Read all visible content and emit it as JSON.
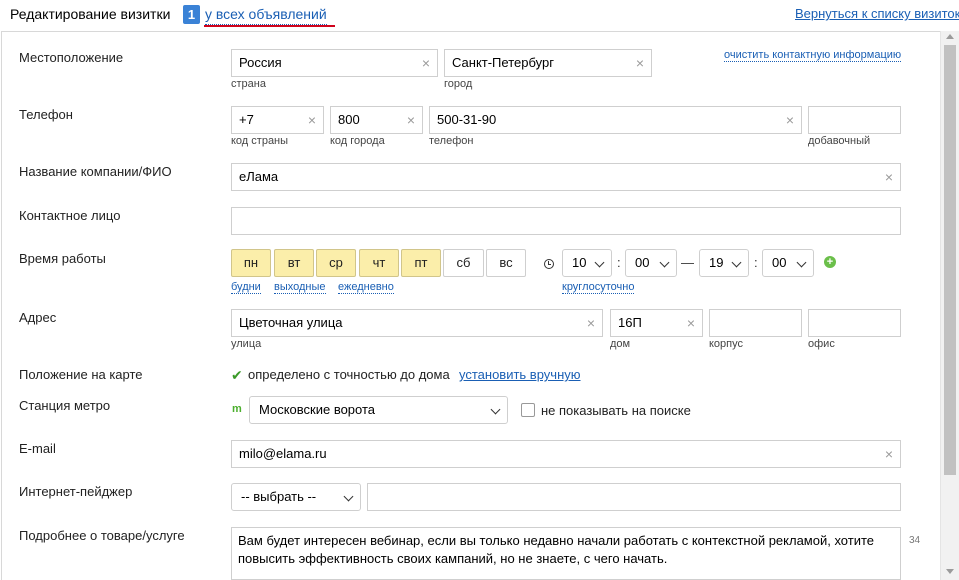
{
  "header": {
    "title": "Редактирование визитки",
    "badge": "1",
    "scope_link": "у всех объявлений",
    "back_link": "Вернуться к списку визиток"
  },
  "location": {
    "label": "Местоположение",
    "country_value": "Россия",
    "country_sub": "страна",
    "city_value": "Санкт-Петербург",
    "city_sub": "город",
    "clear_link": "очистить контактную информацию"
  },
  "phone": {
    "label": "Телефон",
    "country_code": "+7",
    "country_code_sub": "код страны",
    "city_code": "800",
    "city_code_sub": "код города",
    "number": "500-31-90",
    "number_sub": "телефон",
    "extension": "",
    "extension_sub": "добавочный"
  },
  "company": {
    "label": "Название компании/ФИО",
    "value": "еЛама"
  },
  "contact": {
    "label": "Контактное лицо",
    "value": ""
  },
  "hours": {
    "label": "Время работы",
    "days": [
      {
        "label": "пн",
        "active": true
      },
      {
        "label": "вт",
        "active": true
      },
      {
        "label": "ср",
        "active": true
      },
      {
        "label": "чт",
        "active": true
      },
      {
        "label": "пт",
        "active": true
      },
      {
        "label": "сб",
        "active": false
      },
      {
        "label": "вс",
        "active": false
      }
    ],
    "preset_weekdays": "будни",
    "preset_weekend": "выходные",
    "preset_daily": "ежедневно",
    "from_hour": "10",
    "from_min": "00",
    "dash": "—",
    "to_hour": "19",
    "to_min": "00",
    "colon": ":",
    "around_clock": "круглосуточно",
    "plus": "+"
  },
  "address": {
    "label": "Адрес",
    "street": "Цветочная улица",
    "street_sub": "улица",
    "house": "16П",
    "house_sub": "дом",
    "building": "",
    "building_sub": "корпус",
    "office": "",
    "office_sub": "офис"
  },
  "map": {
    "label": "Положение на карте",
    "check": "✔",
    "status": "определено с точностью до дома",
    "set_link": "установить вручную"
  },
  "metro": {
    "label": "Станция метро",
    "icon": "m",
    "station": "Московские ворота",
    "hide_label": "не показывать на поиске"
  },
  "email": {
    "label": "E-mail",
    "value": "milo@elama.ru"
  },
  "pager": {
    "label": "Интернет-пейджер",
    "select": "-- выбрать --",
    "value": ""
  },
  "details": {
    "label": "Подробнее о товаре/услуге",
    "text": "Вам будет интересен вебинар, если вы только недавно начали работать с контекстной рекламой, хотите повысить эффективность своих кампаний, но не знаете, с чего начать.",
    "counter": "34"
  },
  "icons": {
    "clear": "×",
    "clock": "clock-icon",
    "colors": {
      "link": "#1a5fb4",
      "day_active": "#fbeeaa",
      "accent": "#3a82d6",
      "underline": "#d0021b"
    }
  }
}
